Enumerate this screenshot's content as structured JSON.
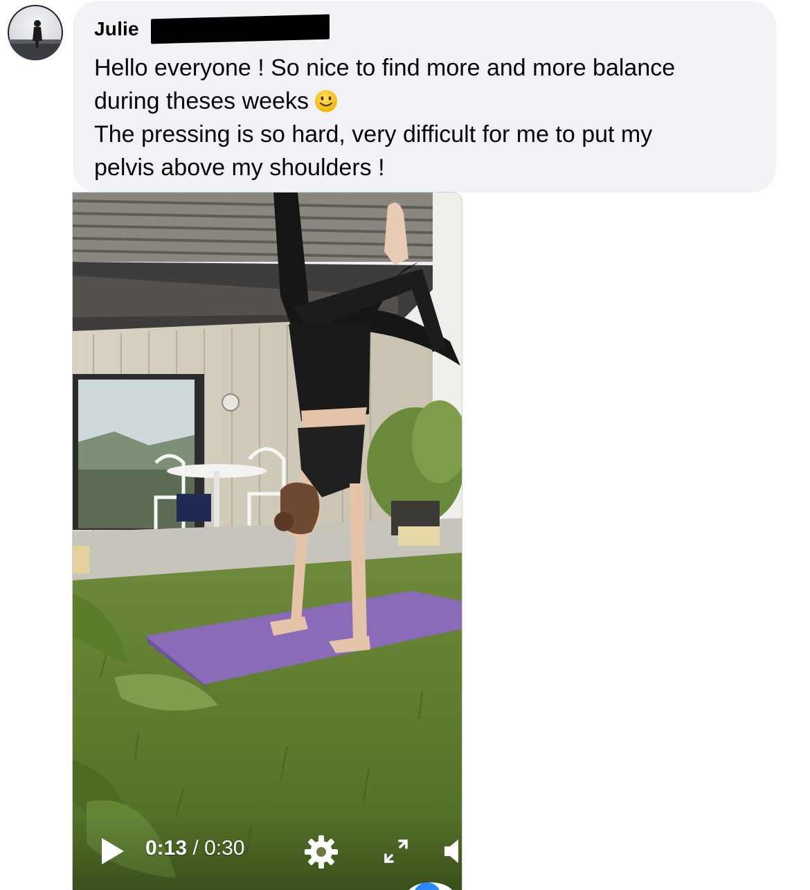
{
  "comment": {
    "author": "Julie",
    "author_redacted": true,
    "lines": [
      "Hello everyone ! So nice to find more and more balance",
      "during theses weeks",
      "The pressing is so hard, very difficult for me to put my",
      "pelvis above my shoulders !"
    ],
    "emoji": "slightly-smiling-face-icon",
    "bubble_color": "#f0f2f5"
  },
  "video": {
    "current_time": "0:13",
    "separator": "/",
    "duration": "0:30",
    "progress": 0.433,
    "icons": [
      "play-icon",
      "gear-icon",
      "fullscreen-icon",
      "volume-icon"
    ]
  }
}
